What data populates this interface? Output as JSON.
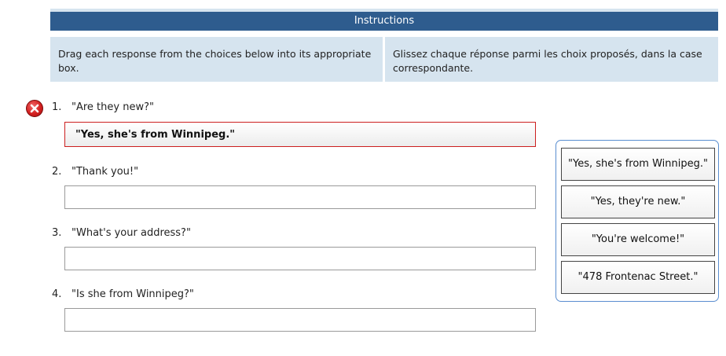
{
  "instructions": {
    "header": "Instructions",
    "english": "Drag each response from the choices below into its appropriate box.",
    "french": "Glissez chaque réponse parmi les choix proposés, dans la case correspondante."
  },
  "questions": [
    {
      "number": "1.",
      "text": "\"Are they new?\"",
      "answer": "\"Yes, she's from Winnipeg.\"",
      "status": "incorrect"
    },
    {
      "number": "2.",
      "text": "\"Thank you!\"",
      "answer": ""
    },
    {
      "number": "3.",
      "text": "\"What's your address?\"",
      "answer": ""
    },
    {
      "number": "4.",
      "text": "\"Is she from Winnipeg?\"",
      "answer": ""
    }
  ],
  "choices": [
    "\"Yes, she's from Winnipeg.\"",
    "\"Yes, they're new.\"",
    "\"You're welcome!\"",
    "\"478 Frontenac Street.\""
  ],
  "colors": {
    "header": "#2e5c8e",
    "panel": "#d6e4ef",
    "error": "#cc1f1f",
    "choices_border": "#5a8ed0"
  },
  "icons": {
    "status": "incorrect-x-icon"
  }
}
